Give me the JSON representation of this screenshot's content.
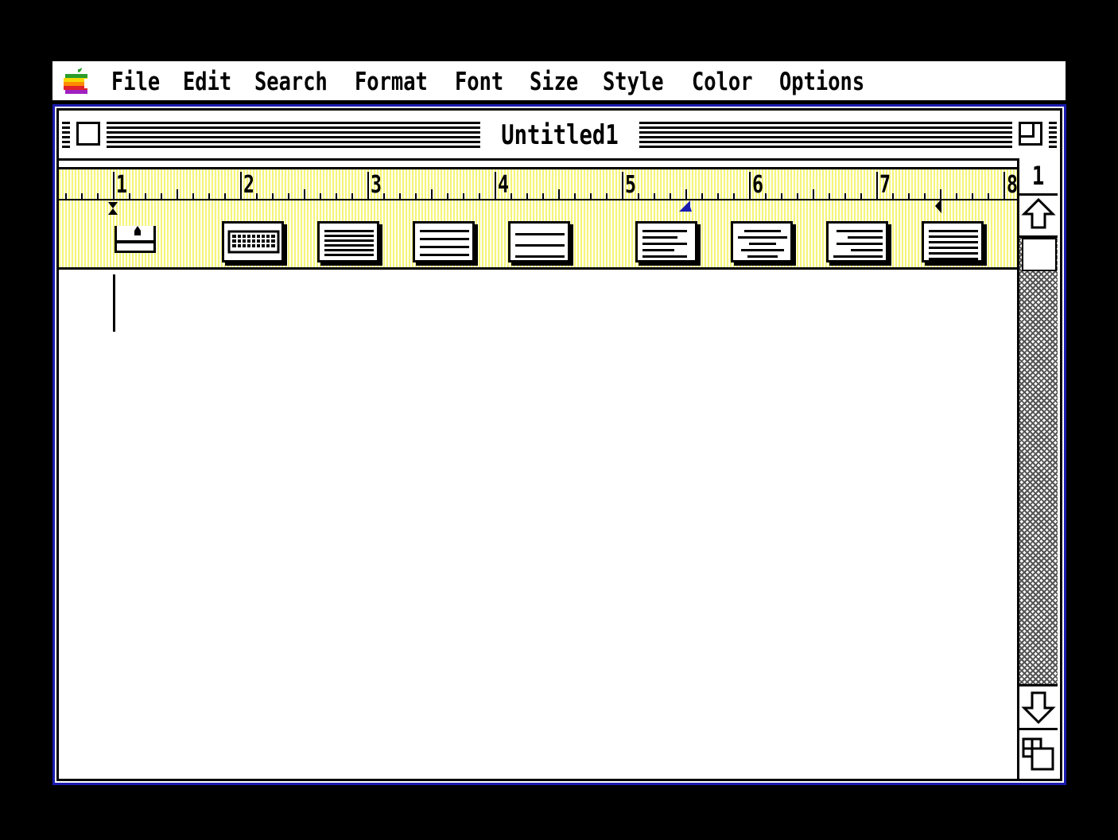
{
  "menubar": {
    "apple_icon": "apple-rainbow-icon",
    "items": [
      "File",
      "Edit",
      "Search",
      "Format",
      "Font",
      "Size",
      "Style",
      "Color",
      "Options"
    ]
  },
  "window": {
    "title": "Untitled1",
    "close_icon": "close-box-icon",
    "zoom_icon": "zoom-box-icon"
  },
  "ruler": {
    "inch_labels": [
      "1",
      "2",
      "3",
      "4",
      "5",
      "6",
      "7",
      "8"
    ],
    "ruler_color": "#f5f57a",
    "tab_marker_color": "#1b1bb0",
    "buttons": [
      {
        "name": "tab-well-button",
        "icon": "decimal-tab-icon"
      },
      {
        "name": "keyboard-button",
        "icon": "keyboard-icon"
      },
      {
        "name": "single-spacing-button",
        "icon": "single-spacing-icon"
      },
      {
        "name": "one-half-spacing-button",
        "icon": "one-half-spacing-icon"
      },
      {
        "name": "double-spacing-button",
        "icon": "double-spacing-icon"
      },
      {
        "name": "align-left-button",
        "icon": "align-left-icon"
      },
      {
        "name": "align-center-button",
        "icon": "align-center-icon"
      },
      {
        "name": "align-right-button",
        "icon": "align-right-icon"
      },
      {
        "name": "justify-button",
        "icon": "justify-icon"
      }
    ]
  },
  "scrollbar": {
    "page_number": "1",
    "up_icon": "up-arrow-icon",
    "down_icon": "down-arrow-icon",
    "grow_icon": "grow-box-icon"
  },
  "colors": {
    "window_border": "#1b1bb0",
    "background": "#000000"
  }
}
